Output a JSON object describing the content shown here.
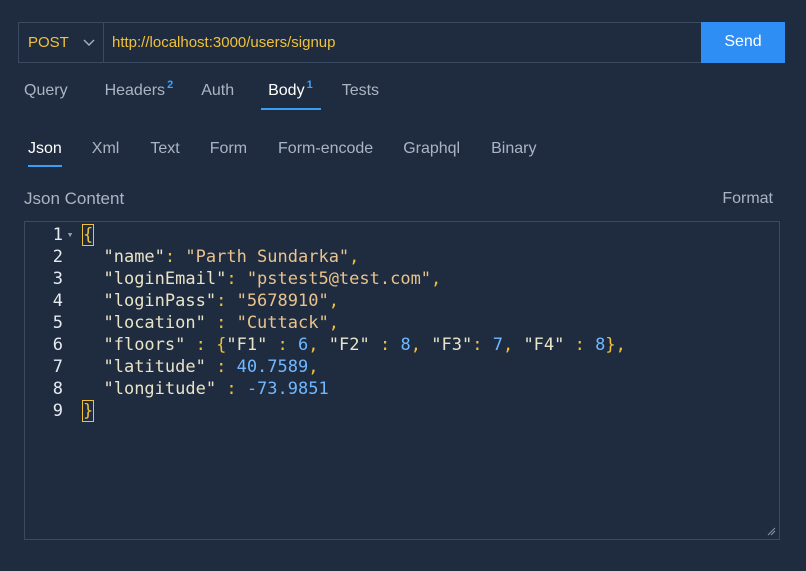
{
  "request": {
    "method": "POST",
    "url": "http://localhost:3000/users/signup",
    "send_label": "Send"
  },
  "tabs": [
    {
      "label": "Query",
      "badge": ""
    },
    {
      "label": "Headers",
      "badge": "2"
    },
    {
      "label": "Auth",
      "badge": ""
    },
    {
      "label": "Body",
      "badge": "1",
      "active": true
    },
    {
      "label": "Tests",
      "badge": ""
    }
  ],
  "body_types": [
    "Json",
    "Xml",
    "Text",
    "Form",
    "Form-encode",
    "Graphql",
    "Binary"
  ],
  "active_body_type": "Json",
  "editor": {
    "label": "Json Content",
    "format_label": "Format",
    "lines": [
      "{",
      "  \"name\": \"Parth Sundarka\",",
      "  \"loginEmail\": \"pstest5@test.com\",",
      "  \"loginPass\": \"5678910\",",
      "  \"location\" : \"Cuttack\",",
      "  \"floors\" : {\"F1\" : 6, \"F2\" : 8, \"F3\": 7, \"F4\" : 8},",
      "  \"latitude\" : 40.7589,",
      "  \"longitude\" : -73.9851",
      "}"
    ]
  },
  "icons": {
    "method_dropdown": "chevron-down-icon",
    "fold_marker": "fold-arrow-icon",
    "resize_handle": "resize-grip-icon"
  },
  "colors": {
    "background": "#1f2b3f",
    "accent": "#2e8ef3",
    "url_text": "#f0c23a",
    "badge": "#3fa2ff"
  }
}
